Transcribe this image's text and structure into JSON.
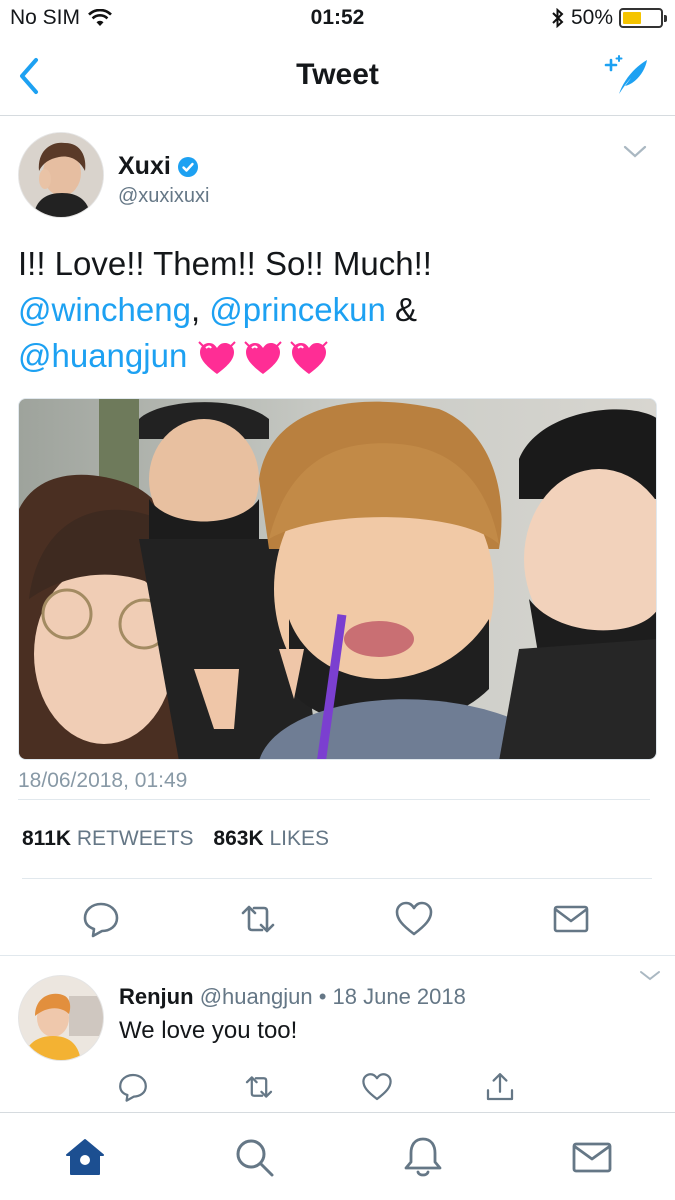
{
  "status_bar": {
    "carrier": "No SIM",
    "time": "01:52",
    "battery_percent": "50%",
    "battery_level": 0.5
  },
  "nav": {
    "title": "Tweet",
    "back_icon": "chevron-left-icon",
    "compose_icon": "compose-feather-icon"
  },
  "tweet": {
    "author_name": "Xuxi",
    "author_handle": "@xuxixuxi",
    "verified": true,
    "text_plain": "I!! Love!! Them!! So!! Much!!",
    "mention_1": "@wincheng",
    "sep_1": ",",
    "mention_2": "@princekun",
    "sep_2": " &",
    "mention_3": "@huangjun",
    "emoji_count": 3,
    "timestamp": "18/06/2018, 01:49",
    "retweets_count": "811K",
    "retweets_label": "RETWEETS",
    "likes_count": "863K",
    "likes_label": "LIKES"
  },
  "reply": {
    "author_name": "Renjun",
    "author_handle": "@huangjun",
    "separator": "•",
    "date": "18 June 2018",
    "text": "We love you too!"
  },
  "colors": {
    "accent": "#1da1f2",
    "text": "#14171a",
    "secondary": "#657786",
    "divider": "#e1e8ed",
    "heart_pink": "#ff2d95",
    "battery": "#f5c400"
  },
  "tab_bar": {
    "items": [
      "home-icon",
      "search-icon",
      "notifications-icon",
      "messages-icon"
    ],
    "active": "home-icon"
  }
}
